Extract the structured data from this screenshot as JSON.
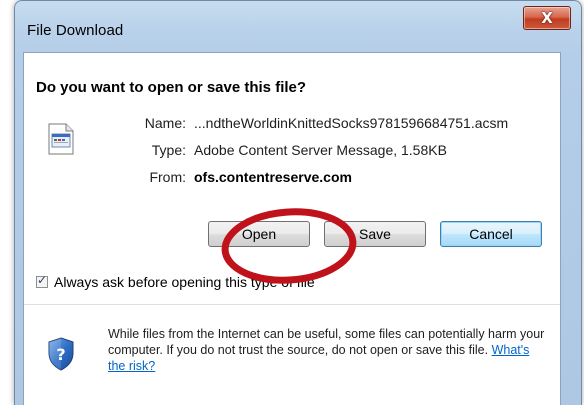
{
  "window": {
    "title": "File Download",
    "close_label": "X"
  },
  "dialog": {
    "question": "Do you want to open or save this file?",
    "file_icon": "file-icon",
    "fields": [
      {
        "label": "Name:",
        "value": "...ndtheWorldinKnittedSocks9781596684751.acsm"
      },
      {
        "label": "Type:",
        "value": "Adobe Content Server Message, 1.58KB"
      },
      {
        "label": "From:",
        "value": "ofs.contentreserve.com"
      }
    ],
    "buttons": {
      "open": "Open",
      "save": "Save",
      "cancel": "Cancel"
    },
    "checkbox": {
      "label": "Always ask before opening this type of file",
      "checked": true
    },
    "warning": {
      "icon": "shield-question-icon",
      "text": "While files from the Internet can be useful, some files can potentially harm your computer. If you do not trust the source, do not open or save this file.",
      "link": "What's the risk?"
    }
  },
  "colors": {
    "annotation": "#c0121b",
    "link": "#0066cc"
  }
}
